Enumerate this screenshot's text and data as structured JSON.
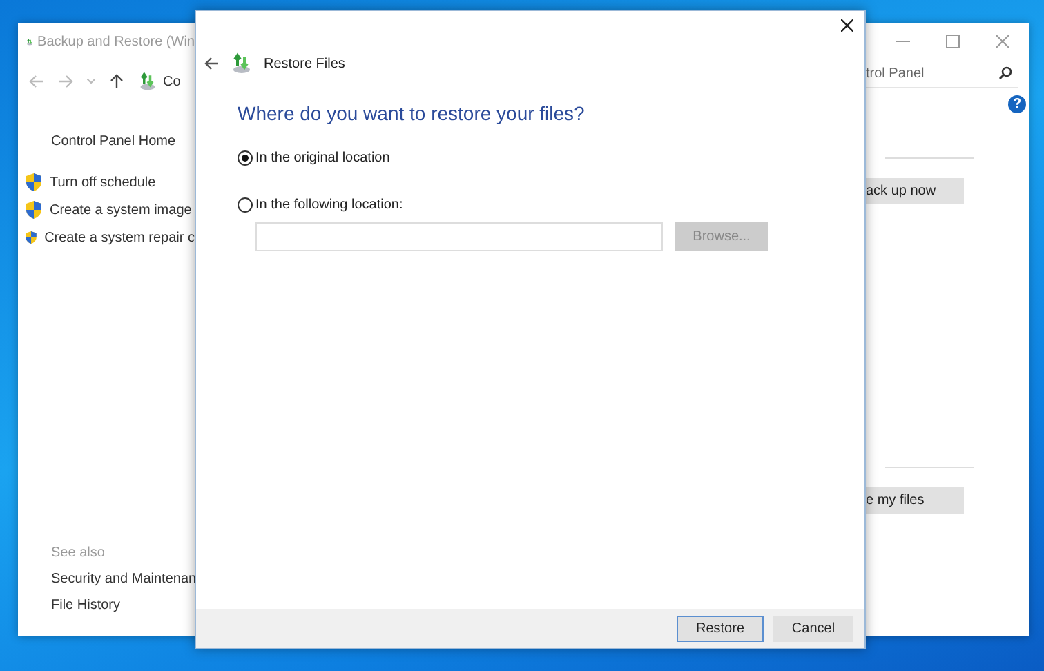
{
  "background_window": {
    "title": "Backup and Restore (Win",
    "address": "Co",
    "search": {
      "value": "trol Panel"
    },
    "help": "?",
    "sidebar": {
      "home": "Control Panel Home",
      "tasks": [
        "Turn off schedule",
        "Create a system image",
        "Create a system repair c"
      ],
      "see_also_heading": "See also",
      "see_also": [
        "Security and Maintenan",
        "File History"
      ]
    },
    "buttons": [
      "ack up now",
      "e my files"
    ]
  },
  "dialog": {
    "title": "Restore Files",
    "heading": "Where do you want to restore your files?",
    "options": [
      {
        "label": "In the original location",
        "selected": true
      },
      {
        "label": "In the following location:",
        "selected": false
      }
    ],
    "browse_button": {
      "label": "Browse...",
      "disabled": true
    },
    "buttons": [
      {
        "label": "Restore",
        "default": true
      },
      {
        "label": "Cancel",
        "default": false
      }
    ]
  }
}
